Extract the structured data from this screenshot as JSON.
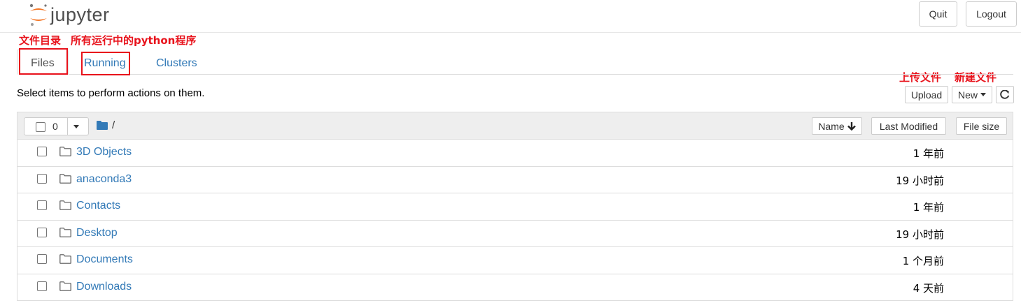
{
  "header": {
    "logo_text": "jupyter",
    "quit_label": "Quit",
    "logout_label": "Logout"
  },
  "annotations": {
    "files_note": "文件目录",
    "running_note": "所有运行中的python程序",
    "upload_note": "上传文件",
    "new_note": "新建文件"
  },
  "tabs": [
    {
      "label": "Files"
    },
    {
      "label": "Running"
    },
    {
      "label": "Clusters"
    }
  ],
  "toolbar": {
    "hint": "Select items to perform actions on them.",
    "upload_label": "Upload",
    "new_label": "New"
  },
  "list_header": {
    "selected_count": "0",
    "path": "/",
    "sort_name_label": "Name",
    "sort_modified_label": "Last Modified",
    "sort_size_label": "File size"
  },
  "files": [
    {
      "name": "3D Objects",
      "modified": "1 年前"
    },
    {
      "name": "anaconda3",
      "modified": "19 小时前"
    },
    {
      "name": "Contacts",
      "modified": "1 年前"
    },
    {
      "name": "Desktop",
      "modified": "19 小时前"
    },
    {
      "name": "Documents",
      "modified": "1 个月前"
    },
    {
      "name": "Downloads",
      "modified": "4 天前"
    }
  ],
  "colors": {
    "link": "#337ab7",
    "annotation": "#e8121b",
    "logo_orange": "#f37626"
  }
}
